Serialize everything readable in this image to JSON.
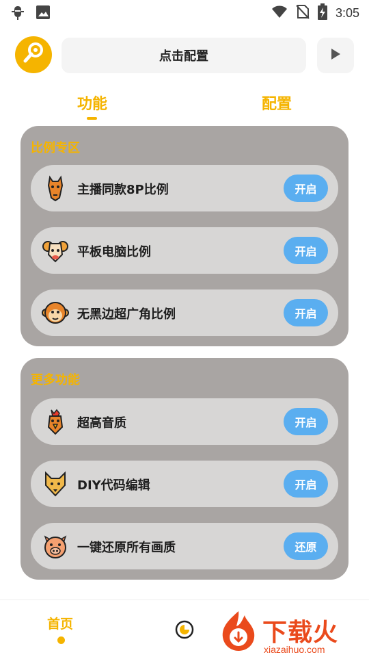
{
  "status_bar": {
    "time": "3:05",
    "left_icons": [
      "bug-icon",
      "image-icon"
    ],
    "right_icons": [
      "wifi-icon",
      "no-sim-icon",
      "battery-charging-icon"
    ]
  },
  "toolbar": {
    "logo_icon": "wrench-icon",
    "config_label": "点击配置",
    "play_icon": "play-icon"
  },
  "tabs": [
    {
      "label": "功能",
      "selected": true
    },
    {
      "label": "配置",
      "selected": false
    }
  ],
  "sections": [
    {
      "title": "比例专区",
      "items": [
        {
          "label": "主播同款8P比例",
          "action": "开启",
          "icon": "horse-icon"
        },
        {
          "label": "平板电脑比例",
          "action": "开启",
          "icon": "ram-icon"
        },
        {
          "label": "无黑边超广角比例",
          "action": "开启",
          "icon": "monkey-icon"
        }
      ]
    },
    {
      "title": "更多功能",
      "items": [
        {
          "label": "超高音质",
          "action": "开启",
          "icon": "rooster-icon"
        },
        {
          "label": "DIY代码编辑",
          "action": "开启",
          "icon": "dog-icon"
        },
        {
          "label": "一键还原所有画质",
          "action": "还原",
          "icon": "pig-icon"
        }
      ]
    }
  ],
  "bottom_nav": {
    "home_label": "首页",
    "chart_icon": "pie-chart-icon"
  },
  "watermark": {
    "text": "下载火",
    "url": "xiazaihuo.com"
  },
  "colors": {
    "accent": "#f5b400",
    "card_bg": "#a9a5a3",
    "row_bg": "#d7d6d5",
    "button_blue": "#5aaef0",
    "watermark": "#ea4a1c"
  }
}
